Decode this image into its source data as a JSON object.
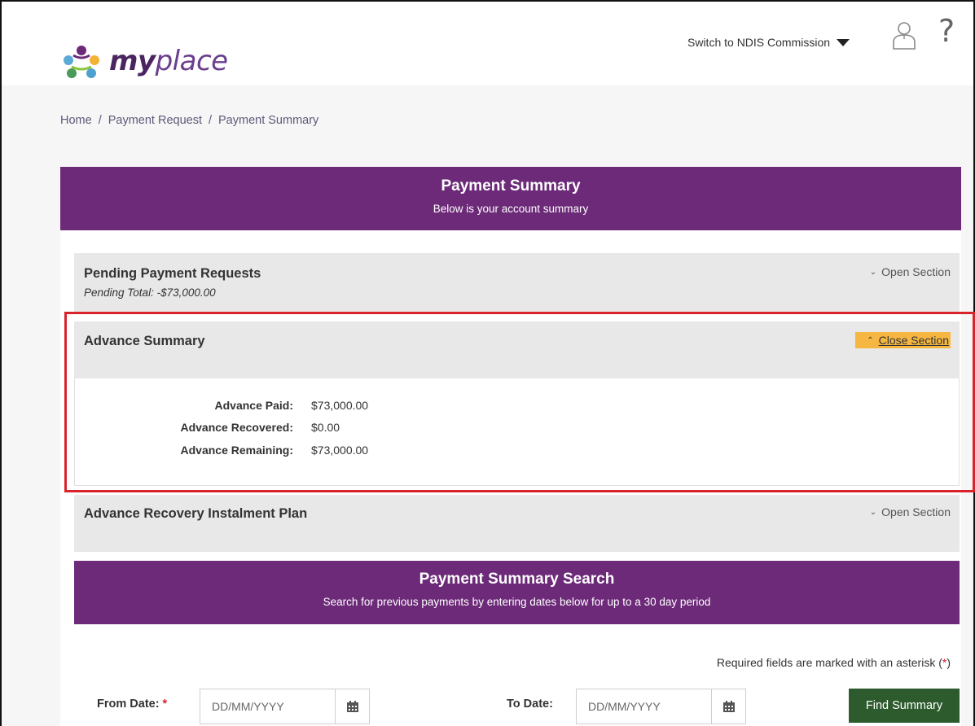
{
  "header": {
    "logo": {
      "my": "my",
      "place": "place"
    },
    "switch_label": "Switch to NDIS Commission",
    "help_symbol": "?"
  },
  "breadcrumb": {
    "items": [
      "Home",
      "Payment Request",
      "Payment Summary"
    ],
    "separator": "/"
  },
  "banner": {
    "title": "Payment Summary",
    "subtitle": "Below is your account summary"
  },
  "sections": {
    "pending": {
      "title": "Pending Payment Requests",
      "subtitle": "Pending Total: -$73,000.00",
      "toggle": "Open Section"
    },
    "advance": {
      "title": "Advance Summary",
      "toggle": "Close Section",
      "rows": [
        {
          "label": "Advance Paid:",
          "value": "$73,000.00"
        },
        {
          "label": "Advance Recovered:",
          "value": "$0.00"
        },
        {
          "label": "Advance Remaining:",
          "value": "$73,000.00"
        }
      ]
    },
    "recovery": {
      "title": "Advance Recovery Instalment Plan",
      "toggle": "Open Section"
    }
  },
  "search": {
    "title": "Payment Summary Search",
    "subtitle": "Search for previous payments by entering dates below for up to a 30 day period",
    "required_note_prefix": "Required fields are marked with an asterisk (",
    "required_note_asterisk": "*",
    "required_note_suffix": ")",
    "from_label": "From Date:",
    "from_asterisk": "*",
    "from_placeholder": "DD/MM/YYYY",
    "to_label": "To Date:",
    "to_placeholder": "DD/MM/YYYY",
    "find_button": "Find Summary"
  },
  "colors": {
    "brand_purple": "#6c2a78",
    "highlight_red": "#d8232a",
    "toggle_amber": "#f6b642",
    "button_green": "#2d5b2e"
  },
  "icons": [
    "myplace-logo-icon",
    "caret-down-icon",
    "user-icon",
    "help-icon",
    "chevron-down-icon",
    "chevron-up-icon",
    "calendar-icon"
  ]
}
